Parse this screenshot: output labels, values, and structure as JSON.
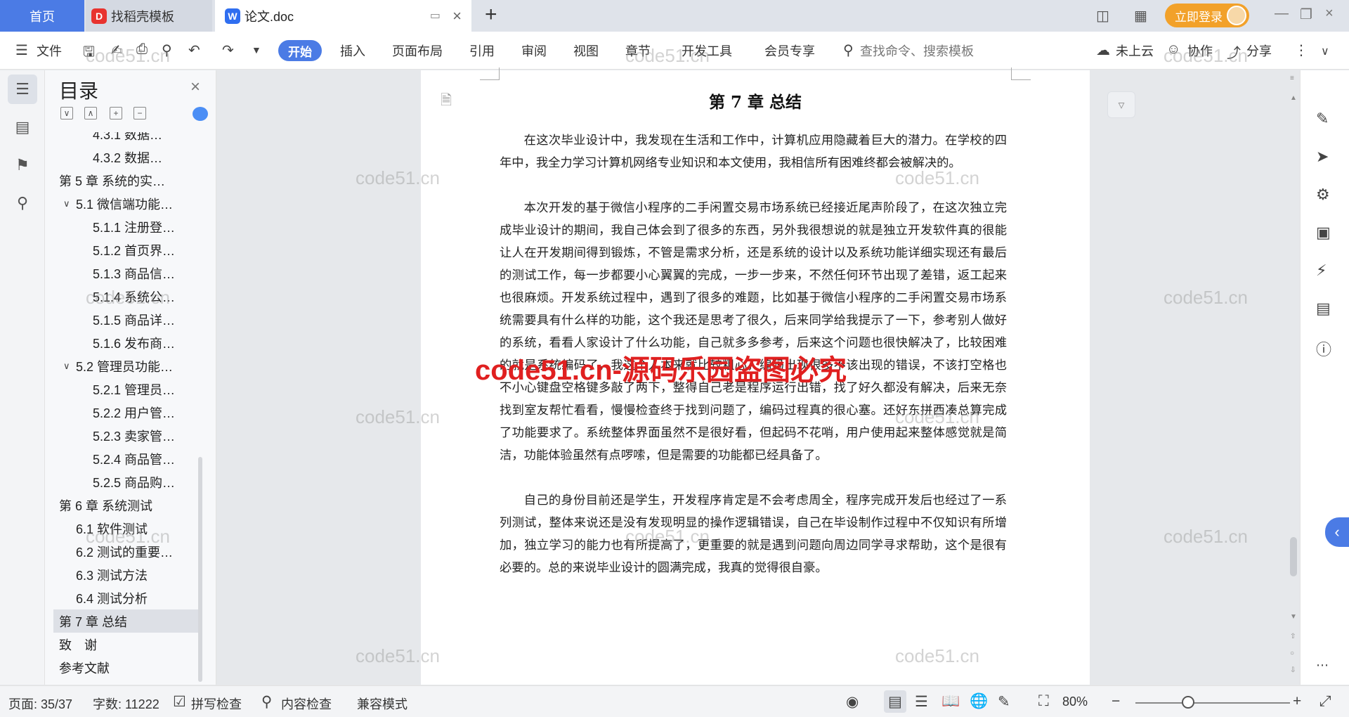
{
  "tabs": {
    "home": "首页",
    "template": "找稻壳模板",
    "doc": "论文.doc",
    "add": "+"
  },
  "account": {
    "login": "立即登录"
  },
  "toolbar": {
    "file": "文件",
    "start": "开始",
    "insert": "插入",
    "layout": "页面布局",
    "reference": "引用",
    "review": "审阅",
    "view": "视图",
    "chapter": "章节",
    "devtools": "开发工具",
    "member": "会员专享",
    "search_placeholder": "查找命令、搜索模板",
    "cloud": "未上云",
    "collab": "协作",
    "share": "分享"
  },
  "toc": {
    "title": "目录",
    "items": [
      {
        "label": "4.3.1 数据…",
        "level": 3
      },
      {
        "label": "4.3.2 数据…",
        "level": 3
      },
      {
        "label": "第 5 章  系统的实…",
        "level": 1,
        "expanded": true
      },
      {
        "label": "5.1 微信端功能…",
        "level": 2,
        "expanded": true
      },
      {
        "label": "5.1.1 注册登…",
        "level": 3
      },
      {
        "label": "5.1.2 首页界…",
        "level": 3
      },
      {
        "label": "5.1.3 商品信…",
        "level": 3
      },
      {
        "label": "5.1.4 系统公…",
        "level": 3
      },
      {
        "label": "5.1.5 商品详…",
        "level": 3
      },
      {
        "label": "5.1.6 发布商…",
        "level": 3
      },
      {
        "label": "5.2 管理员功能…",
        "level": 2,
        "expanded": true
      },
      {
        "label": "5.2.1 管理员…",
        "level": 3
      },
      {
        "label": "5.2.2 用户管…",
        "level": 3
      },
      {
        "label": "5.2.3 卖家管…",
        "level": 3
      },
      {
        "label": "5.2.4 商品管…",
        "level": 3
      },
      {
        "label": "5.2.5 商品购…",
        "level": 3
      },
      {
        "label": "第 6 章  系统测试",
        "level": 1,
        "expanded": true
      },
      {
        "label": "6.1 软件测试",
        "level": 2
      },
      {
        "label": "6.2 测试的重要…",
        "level": 2
      },
      {
        "label": "6.3 测试方法",
        "level": 2
      },
      {
        "label": "6.4 测试分析",
        "level": 2
      },
      {
        "label": "第 7 章  总结",
        "level": 1,
        "active": true
      },
      {
        "label": "致　谢",
        "level": 1
      },
      {
        "label": "参考文献",
        "level": 1
      }
    ]
  },
  "document": {
    "heading": "第 7 章  总结",
    "paragraphs": [
      "在这次毕业设计中，我发现在生活和工作中，计算机应用隐藏着巨大的潜力。在学校的四年中，我全力学习计算机网络专业知识和本文使用，我相信所有困难终都会被解决的。",
      "本次开发的基于微信小程序的二手闲置交易市场系统已经接近尾声阶段了，在这次独立完成毕业设计的期间，我自己体会到了很多的东西，另外我很想说的就是独立开发软件真的很能让人在开发期间得到锻炼，不管是需求分析，还是系统的设计以及系统功能详细实现还有最后的测试工作，每一步都要小心翼翼的完成，一步一步来，不然任何环节出现了差错，返工起来也很麻烦。开发系统过程中，遇到了很多的难题，比如基于微信小程序的二手闲置交易市场系统需要具有什么样的功能，这个我还是思考了很久，后来同学给我提示了一下，参考别人做好的系统，看看人家设计了什么功能，自己就多多参考，后来这个问题也很快解决了，比较困难的就是系统编码了，我这个人本来就比较粗心，编码出现很多不该出现的错误，不该打空格也不小心键盘空格键多敲了两下，整得自己老是程序运行出错，找了好久都没有解决，后来无奈找到室友帮忙看看，慢慢检查终于找到问题了，编码过程真的很心塞。还好东拼西凑总算完成了功能要求了。系统整体界面虽然不是很好看，但起码不花哨，用户使用起来整体感觉就是简洁，功能体验虽然有点啰嗦，但是需要的功能都已经具备了。",
      "自己的身份目前还是学生，开发程序肯定是不会考虑周全，程序完成开发后也经过了一系列测试，整体来说还是没有发现明显的操作逻辑错误，自己在毕设制作过程中不仅知识有所增加，独立学习的能力也有所提高了，更重要的就是遇到问题向周边同学寻求帮助，这个是很有必要的。总的来说毕业设计的圆满完成，我真的觉得很自豪。"
    ]
  },
  "watermark": {
    "site": "code51.cn",
    "banner": "code51.cn-源码乐园盗图必究"
  },
  "status": {
    "page": "页面: 35/37",
    "words": "字数: 11222",
    "spell": "拼写检查",
    "content_check": "内容检查",
    "compat": "兼容模式",
    "zoom": "80%"
  },
  "colors": {
    "accent": "#4b7be5",
    "login": "#f2a12a",
    "watermark_red": "#e02020"
  },
  "icons": {
    "save": "save-icon",
    "undo": "undo-icon",
    "redo": "redo-icon",
    "search": "search-icon"
  }
}
